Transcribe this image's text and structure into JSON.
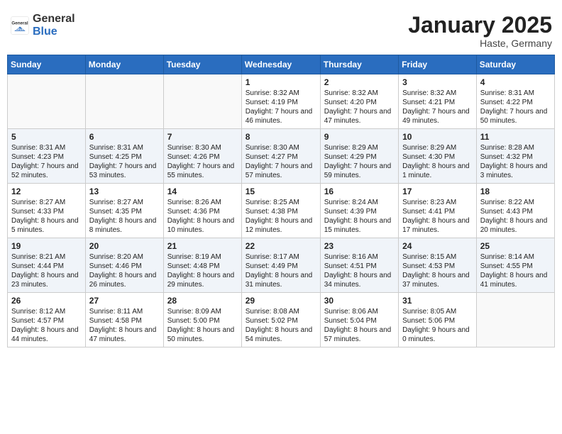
{
  "header": {
    "logo_general": "General",
    "logo_blue": "Blue",
    "month_title": "January 2025",
    "location": "Haste, Germany"
  },
  "weekdays": [
    "Sunday",
    "Monday",
    "Tuesday",
    "Wednesday",
    "Thursday",
    "Friday",
    "Saturday"
  ],
  "weeks": [
    [
      {
        "day": "",
        "info": ""
      },
      {
        "day": "",
        "info": ""
      },
      {
        "day": "",
        "info": ""
      },
      {
        "day": "1",
        "info": "Sunrise: 8:32 AM\nSunset: 4:19 PM\nDaylight: 7 hours and 46 minutes."
      },
      {
        "day": "2",
        "info": "Sunrise: 8:32 AM\nSunset: 4:20 PM\nDaylight: 7 hours and 47 minutes."
      },
      {
        "day": "3",
        "info": "Sunrise: 8:32 AM\nSunset: 4:21 PM\nDaylight: 7 hours and 49 minutes."
      },
      {
        "day": "4",
        "info": "Sunrise: 8:31 AM\nSunset: 4:22 PM\nDaylight: 7 hours and 50 minutes."
      }
    ],
    [
      {
        "day": "5",
        "info": "Sunrise: 8:31 AM\nSunset: 4:23 PM\nDaylight: 7 hours and 52 minutes."
      },
      {
        "day": "6",
        "info": "Sunrise: 8:31 AM\nSunset: 4:25 PM\nDaylight: 7 hours and 53 minutes."
      },
      {
        "day": "7",
        "info": "Sunrise: 8:30 AM\nSunset: 4:26 PM\nDaylight: 7 hours and 55 minutes."
      },
      {
        "day": "8",
        "info": "Sunrise: 8:30 AM\nSunset: 4:27 PM\nDaylight: 7 hours and 57 minutes."
      },
      {
        "day": "9",
        "info": "Sunrise: 8:29 AM\nSunset: 4:29 PM\nDaylight: 7 hours and 59 minutes."
      },
      {
        "day": "10",
        "info": "Sunrise: 8:29 AM\nSunset: 4:30 PM\nDaylight: 8 hours and 1 minute."
      },
      {
        "day": "11",
        "info": "Sunrise: 8:28 AM\nSunset: 4:32 PM\nDaylight: 8 hours and 3 minutes."
      }
    ],
    [
      {
        "day": "12",
        "info": "Sunrise: 8:27 AM\nSunset: 4:33 PM\nDaylight: 8 hours and 5 minutes."
      },
      {
        "day": "13",
        "info": "Sunrise: 8:27 AM\nSunset: 4:35 PM\nDaylight: 8 hours and 8 minutes."
      },
      {
        "day": "14",
        "info": "Sunrise: 8:26 AM\nSunset: 4:36 PM\nDaylight: 8 hours and 10 minutes."
      },
      {
        "day": "15",
        "info": "Sunrise: 8:25 AM\nSunset: 4:38 PM\nDaylight: 8 hours and 12 minutes."
      },
      {
        "day": "16",
        "info": "Sunrise: 8:24 AM\nSunset: 4:39 PM\nDaylight: 8 hours and 15 minutes."
      },
      {
        "day": "17",
        "info": "Sunrise: 8:23 AM\nSunset: 4:41 PM\nDaylight: 8 hours and 17 minutes."
      },
      {
        "day": "18",
        "info": "Sunrise: 8:22 AM\nSunset: 4:43 PM\nDaylight: 8 hours and 20 minutes."
      }
    ],
    [
      {
        "day": "19",
        "info": "Sunrise: 8:21 AM\nSunset: 4:44 PM\nDaylight: 8 hours and 23 minutes."
      },
      {
        "day": "20",
        "info": "Sunrise: 8:20 AM\nSunset: 4:46 PM\nDaylight: 8 hours and 26 minutes."
      },
      {
        "day": "21",
        "info": "Sunrise: 8:19 AM\nSunset: 4:48 PM\nDaylight: 8 hours and 29 minutes."
      },
      {
        "day": "22",
        "info": "Sunrise: 8:17 AM\nSunset: 4:49 PM\nDaylight: 8 hours and 31 minutes."
      },
      {
        "day": "23",
        "info": "Sunrise: 8:16 AM\nSunset: 4:51 PM\nDaylight: 8 hours and 34 minutes."
      },
      {
        "day": "24",
        "info": "Sunrise: 8:15 AM\nSunset: 4:53 PM\nDaylight: 8 hours and 37 minutes."
      },
      {
        "day": "25",
        "info": "Sunrise: 8:14 AM\nSunset: 4:55 PM\nDaylight: 8 hours and 41 minutes."
      }
    ],
    [
      {
        "day": "26",
        "info": "Sunrise: 8:12 AM\nSunset: 4:57 PM\nDaylight: 8 hours and 44 minutes."
      },
      {
        "day": "27",
        "info": "Sunrise: 8:11 AM\nSunset: 4:58 PM\nDaylight: 8 hours and 47 minutes."
      },
      {
        "day": "28",
        "info": "Sunrise: 8:09 AM\nSunset: 5:00 PM\nDaylight: 8 hours and 50 minutes."
      },
      {
        "day": "29",
        "info": "Sunrise: 8:08 AM\nSunset: 5:02 PM\nDaylight: 8 hours and 54 minutes."
      },
      {
        "day": "30",
        "info": "Sunrise: 8:06 AM\nSunset: 5:04 PM\nDaylight: 8 hours and 57 minutes."
      },
      {
        "day": "31",
        "info": "Sunrise: 8:05 AM\nSunset: 5:06 PM\nDaylight: 9 hours and 0 minutes."
      },
      {
        "day": "",
        "info": ""
      }
    ]
  ]
}
